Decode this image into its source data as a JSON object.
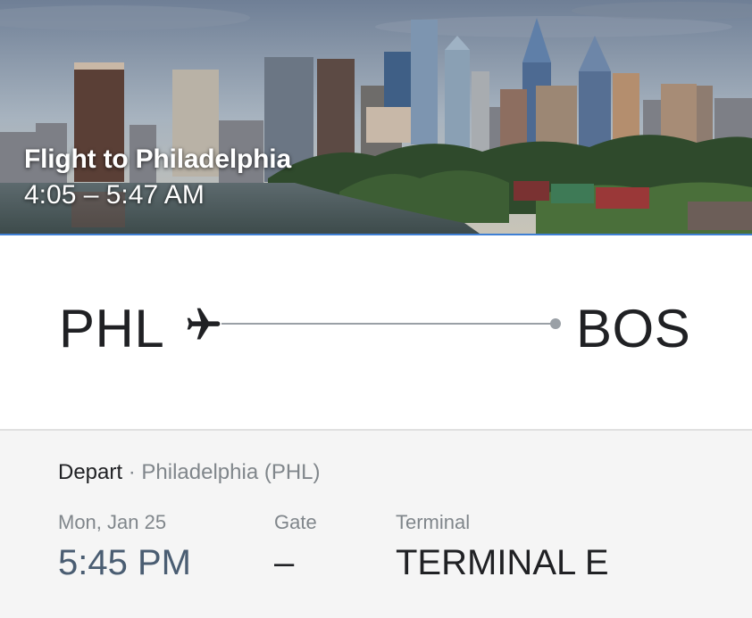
{
  "hero": {
    "title": "Flight to Philadelphia",
    "time_range": "4:05 – 5:47 AM",
    "accent_color": "#3f7fd4"
  },
  "route": {
    "origin": "PHL",
    "destination": "BOS",
    "icon": "airplane-icon"
  },
  "details": {
    "direction": "Depart",
    "separator": "·",
    "place": "Philadelphia (PHL)",
    "columns": [
      {
        "label": "Mon, Jan 25",
        "value": "5:45 PM"
      },
      {
        "label": "Gate",
        "value": "–"
      },
      {
        "label": "Terminal",
        "value": "TERMINAL E"
      }
    ]
  }
}
